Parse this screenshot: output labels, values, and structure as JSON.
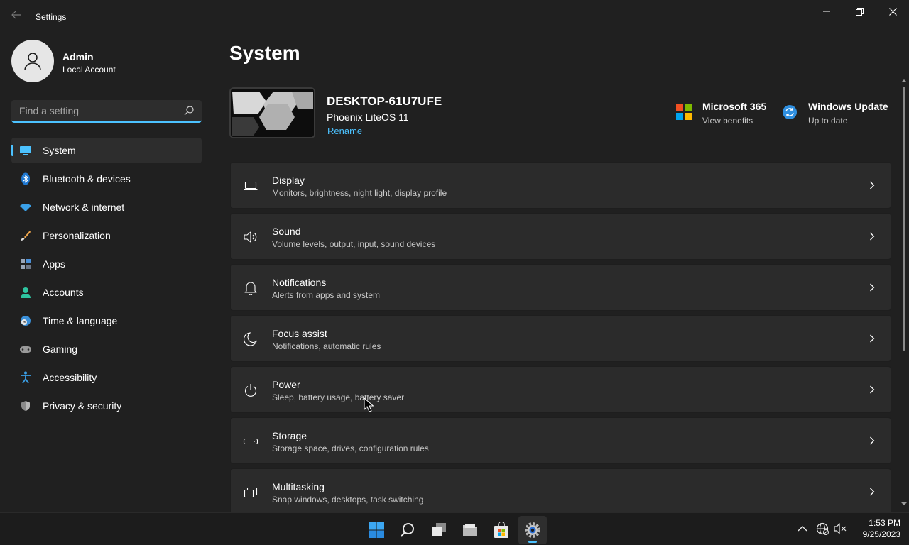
{
  "window": {
    "title": "Settings"
  },
  "profile": {
    "name": "Admin",
    "account_type": "Local Account"
  },
  "search": {
    "placeholder": "Find a setting"
  },
  "sidebar": {
    "items": [
      {
        "label": "System",
        "icon": "monitor-icon",
        "active": true
      },
      {
        "label": "Bluetooth & devices",
        "icon": "bluetooth-icon"
      },
      {
        "label": "Network & internet",
        "icon": "wifi-icon"
      },
      {
        "label": "Personalization",
        "icon": "brush-icon"
      },
      {
        "label": "Apps",
        "icon": "apps-icon"
      },
      {
        "label": "Accounts",
        "icon": "person-icon"
      },
      {
        "label": "Time & language",
        "icon": "globe-clock-icon"
      },
      {
        "label": "Gaming",
        "icon": "gamepad-icon"
      },
      {
        "label": "Accessibility",
        "icon": "accessibility-icon"
      },
      {
        "label": "Privacy & security",
        "icon": "shield-icon"
      }
    ]
  },
  "main": {
    "title": "System",
    "device": {
      "name": "DESKTOP-61U7UFE",
      "os": "Phoenix LiteOS 11",
      "rename_label": "Rename"
    },
    "promos": [
      {
        "title": "Microsoft 365",
        "subtitle": "View benefits",
        "icon": "microsoft-logo-icon"
      },
      {
        "title": "Windows Update",
        "subtitle": "Up to date",
        "icon": "sync-icon"
      }
    ],
    "settings": [
      {
        "title": "Display",
        "subtitle": "Monitors, brightness, night light, display profile",
        "icon": "laptop-icon"
      },
      {
        "title": "Sound",
        "subtitle": "Volume levels, output, input, sound devices",
        "icon": "speaker-icon"
      },
      {
        "title": "Notifications",
        "subtitle": "Alerts from apps and system",
        "icon": "bell-icon"
      },
      {
        "title": "Focus assist",
        "subtitle": "Notifications, automatic rules",
        "icon": "moon-icon"
      },
      {
        "title": "Power",
        "subtitle": "Sleep, battery usage, battery saver",
        "icon": "power-icon"
      },
      {
        "title": "Storage",
        "subtitle": "Storage space, drives, configuration rules",
        "icon": "storage-icon"
      },
      {
        "title": "Multitasking",
        "subtitle": "Snap windows, desktops, task switching",
        "icon": "multitasking-icon"
      }
    ]
  },
  "taskbar": {
    "apps": [
      "start-icon",
      "search-icon",
      "task-view-icon",
      "file-explorer-icon",
      "store-icon",
      "settings-icon"
    ],
    "tray": [
      "chevron-up-icon",
      "network-globe-icon",
      "volume-muted-icon"
    ],
    "time": "1:53 PM",
    "date": "9/25/2023"
  },
  "colors": {
    "accent": "#4cc2ff",
    "background": "#202020",
    "card": "#2b2b2b"
  }
}
